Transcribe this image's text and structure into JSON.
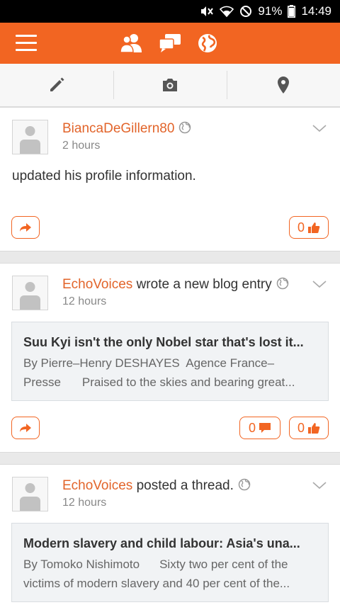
{
  "status_bar": {
    "battery": "91%",
    "time": "14:49",
    "icons": [
      "mute-icon",
      "wifi-icon",
      "do-not-disturb-icon",
      "battery-icon"
    ]
  },
  "app_bar": {
    "menu_icon": "hamburger-menu-icon",
    "tabs": [
      "people-icon",
      "chat-bubbles-icon",
      "globe-icon"
    ],
    "accent": "#f26522"
  },
  "composer": {
    "actions": [
      "pencil-icon",
      "camera-icon",
      "location-pin-icon"
    ]
  },
  "feed": [
    {
      "user": "BiancaDeGillern80",
      "action": "",
      "time": "2 hours",
      "text": "updated his profile information.",
      "likes": "0"
    },
    {
      "user": "EchoVoices",
      "action": "wrote a new blog entry",
      "time": "12 hours",
      "embed": {
        "title": "Suu Kyi isn't the only Nobel star that's lost it...",
        "byline": "By Pierre–Henry DESHAYES",
        "desc_line1_rest": "Agence France–",
        "desc_line2_a": "Presse",
        "desc_line2_b": "Praised to the skies and bearing great..."
      },
      "comments": "0",
      "likes": "0"
    },
    {
      "user": "EchoVoices",
      "action": "posted a thread.",
      "time": "12 hours",
      "embed": {
        "title": "Modern slavery and child labour: Asia's una...",
        "byline": "By Tomoko Nishimoto",
        "desc_line1_rest": "Sixty two per cent of the",
        "desc_line2": "victims of modern slavery and 40 per cent of the..."
      }
    }
  ]
}
